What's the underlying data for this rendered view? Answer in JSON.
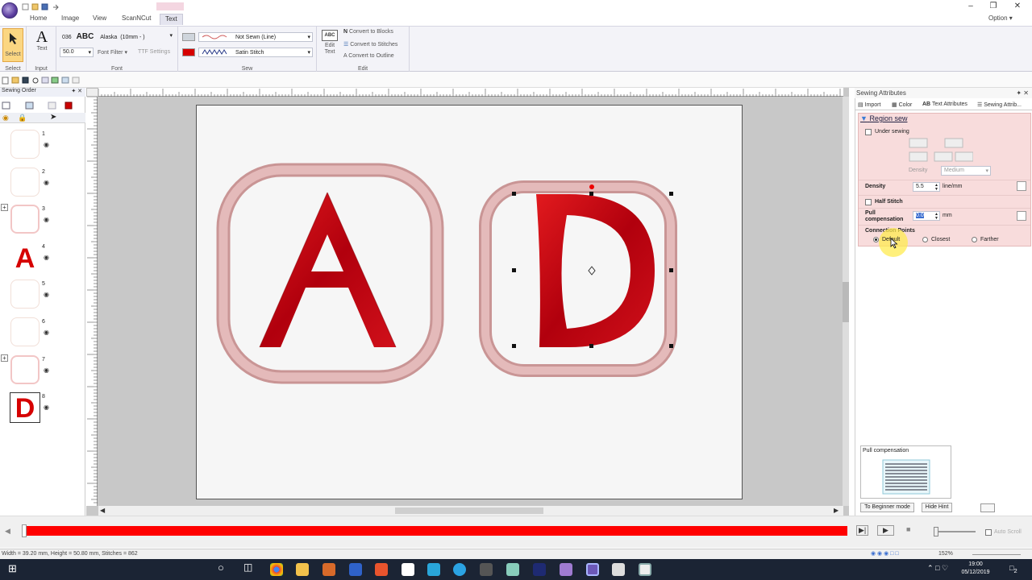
{
  "menu": {
    "tabs": [
      "Home",
      "Image",
      "View",
      "ScanNCut",
      "Text"
    ],
    "active_tab": "Text",
    "option": "Option"
  },
  "ribbon": {
    "select_label": "Select",
    "text_label": "Text",
    "groups": {
      "select": "Select",
      "input": "Input",
      "font": "Font",
      "sew": "Sew",
      "edit": "Edit"
    },
    "font_code": "036",
    "font_preview": "ABC",
    "font_name": "Alaska",
    "font_size_desc": "(10mm - )",
    "size_value": "50.0",
    "font_filter": "Font Filter",
    "ttf_settings": "TTF Settings",
    "line_sew": "Not Sewn (Line)",
    "region_sew": "Satin Stitch",
    "edit_text_label": "Edit Text",
    "edit_text_icon": "ABC",
    "convert_blocks": "Convert to Blocks",
    "convert_stitches": "Convert to Stitches",
    "convert_outline": "Convert to Outline",
    "accent_line": "#7a8899",
    "accent_region": "#d60000"
  },
  "sewing_order": {
    "title": "Sewing Order",
    "items": [
      {
        "num": "1",
        "glyph": ""
      },
      {
        "num": "2",
        "glyph": ""
      },
      {
        "num": "3",
        "glyph": ""
      },
      {
        "num": "4",
        "glyph": "A"
      },
      {
        "num": "5",
        "glyph": ""
      },
      {
        "num": "6",
        "glyph": ""
      },
      {
        "num": "7",
        "glyph": ""
      },
      {
        "num": "8",
        "glyph": "D"
      }
    ]
  },
  "canvas": {
    "letter_a": "A",
    "letter_d": "D",
    "thread_red": "#c9000b",
    "frame_pink": "#d8a7a7"
  },
  "attributes": {
    "panel_title": "Sewing Attributes",
    "tabs": [
      "Import",
      "Color",
      "Text Attributes",
      "Sewing Attrib..."
    ],
    "section": "Region sew",
    "under_sewing": "Under sewing",
    "density_small": "Density",
    "density_small_value": "Medium",
    "density": "Density",
    "density_value": "5.5",
    "density_unit": "line/mm",
    "half_stitch": "Half Stitch",
    "pull_comp": "Pull compensation",
    "pull_value": "0.0",
    "pull_unit": "mm",
    "connection_points": "Connection Points",
    "opt_default": "Default",
    "opt_closest": "Closest",
    "opt_farther": "Farther",
    "hint_title": "Pull compensation",
    "beginner_btn": "To Beginner mode",
    "hide_hint_btn": "Hide Hint"
  },
  "status": {
    "text": "Width = 39.20 mm, Height = 50.80 mm, Stitches = 862",
    "zoom": "152%",
    "autoscroll": "Auto Scroll"
  },
  "taskbar": {
    "time": "19:00",
    "date": "05/12/2019",
    "notif_count": "2"
  }
}
